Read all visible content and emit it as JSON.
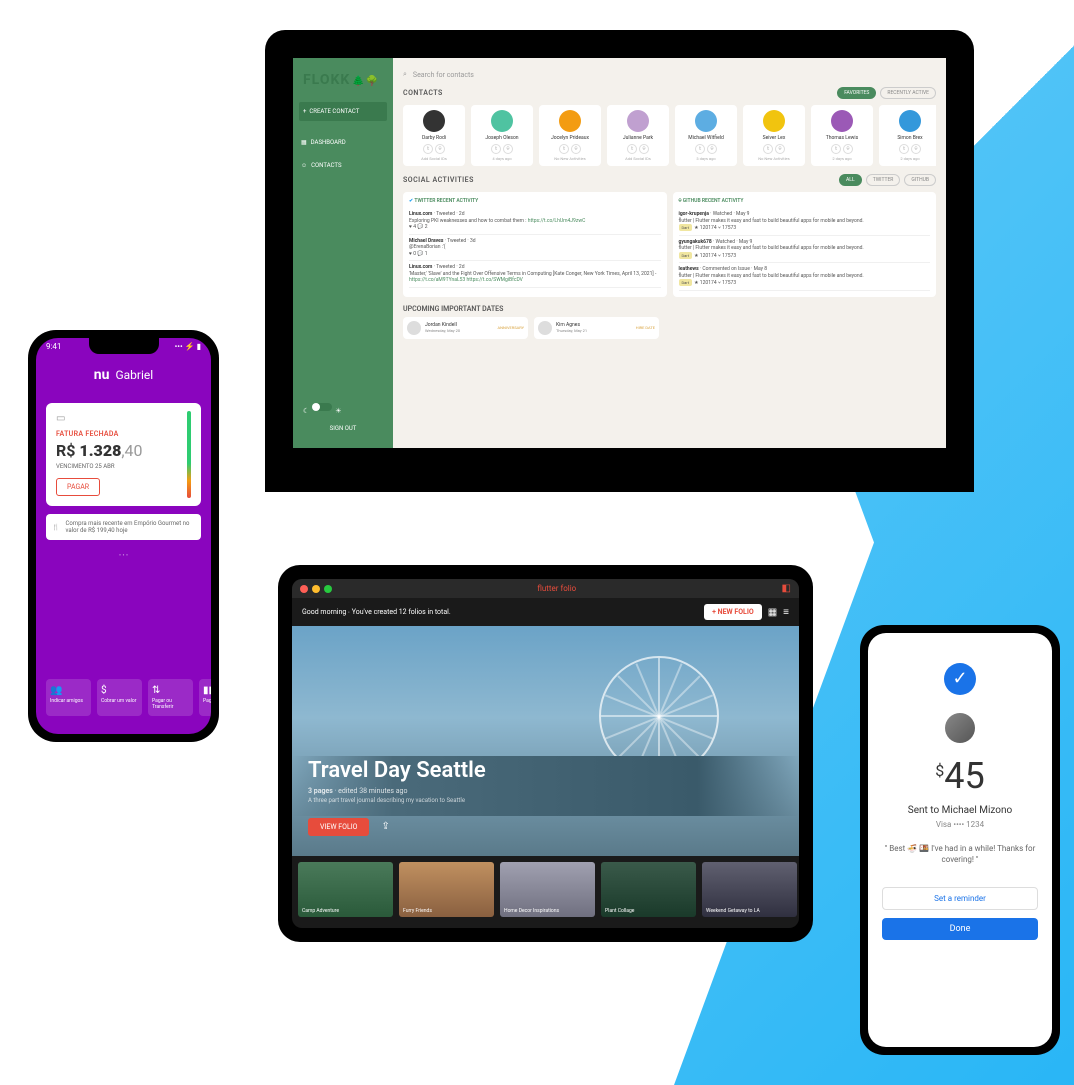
{
  "flokk": {
    "logo": "FLOKK",
    "search_placeholder": "Search for contacts",
    "create_contact": "CREATE CONTACT",
    "nav_dashboard": "DASHBOARD",
    "nav_contacts": "CONTACTS",
    "sign_out": "SIGN OUT",
    "contacts_heading": "CONTACTS",
    "tab_favorites": "FAVORITES",
    "tab_recently": "RECENTLY ACTIVE",
    "contacts": [
      {
        "name": "Darby Rodi",
        "meta": "Add Social IDs"
      },
      {
        "name": "Joseph Oleson",
        "meta": "4 days ago"
      },
      {
        "name": "Jocelyn Prideaux",
        "meta": "No New Activities"
      },
      {
        "name": "Julianne Park",
        "meta": "Add Social IDs"
      },
      {
        "name": "Michael Witfield",
        "meta": "3 days ago"
      },
      {
        "name": "Seiver Lex",
        "meta": "No New Activities"
      },
      {
        "name": "Thomas Lewis",
        "meta": "2 days ago"
      },
      {
        "name": "Simon Brex",
        "meta": "2 days ago"
      }
    ],
    "social_heading": "SOCIAL ACTIVITIES",
    "social_tab_all": "ALL",
    "social_tab_twitter": "TWITTER",
    "social_tab_github": "GITHUB",
    "twitter_header": "TWITTER RECENT ACTIVITY",
    "github_header": "GITHUB RECENT ACTIVITY",
    "twitter_items": [
      {
        "who": "Linux.com",
        "action": "Tweeted · 2d",
        "text": "Exploring PKI weaknesses and how to combat them :",
        "link": "https://t.co/LhUm4J9zwC",
        "stats": "♥ 4  💬 2"
      },
      {
        "who": "Michael Draves",
        "action": "Tweeted · 3d",
        "text": "@ErenaBorian :'(",
        "stats": "♥ 0  💬 1"
      },
      {
        "who": "Linux.com",
        "action": "Tweeted · 2d",
        "text": "'Master,' 'Slave' and the Fight Over Offensive Terms in Computing [Kate Conger, New York Times, April 13, 2021] -",
        "link": "https://t.co/aM9TYnaL53 https://t.co/SWMgiBfcDV"
      }
    ],
    "github_items": [
      {
        "who": "igor-krupenja",
        "action": "Watched · May 9",
        "text": "flutter | Flutter makes it easy and fast to build beautiful apps for mobile and beyond.",
        "lang": "Dart",
        "stats": "★ 120174  ⑂ 17573"
      },
      {
        "who": "gyungakuk678",
        "action": "Watched · May 9",
        "text": "flutter | Flutter makes it easy and fast to build beautiful apps for mobile and beyond.",
        "lang": "Dart",
        "stats": "★ 120174  ⑂ 17573"
      },
      {
        "who": "leathews",
        "action": "Commented on Issue · May 8",
        "text": "flutter | Flutter makes it easy and fast to build beautiful apps for mobile and beyond.",
        "lang": "Dart",
        "stats": "★ 120174  ⑂ 17573"
      }
    ],
    "dates_heading": "UPCOMING IMPORTANT DATES",
    "dates": [
      {
        "name": "Jordan Kindell",
        "badge": "ANNIVERSARY",
        "date": "Wednesday, May 20"
      },
      {
        "name": "Kim Agnes",
        "badge": "HIRE DATE",
        "date": "Thursday, May 21"
      }
    ]
  },
  "nubank": {
    "time": "9:41",
    "user": "Gabriel",
    "label": "FATURA FECHADA",
    "currency": "R$",
    "amount_int": "1.328",
    "amount_cents": ",40",
    "due": "VENCIMENTO 25 ABR",
    "pagar": "PAGAR",
    "recent": "Compra mais recente em Empório Gourmet no valor de R$ 199,40 hoje",
    "actions": [
      {
        "label": "Indicar amigos"
      },
      {
        "label": "Cobrar um valor"
      },
      {
        "label": "Pagar ou Transferir"
      },
      {
        "label": "Pagar boleto"
      }
    ]
  },
  "folio": {
    "title": "flutter folio",
    "greeting": "Good morning ∙ You've created 12 folios in total.",
    "new_folio": "+ NEW FOLIO",
    "hero_title": "Travel Day Seattle",
    "hero_pages": "3 pages",
    "hero_edited": "edited 38 minutes ago",
    "hero_desc": "A three part travel journal describing my vacation to Seattle",
    "view_btn": "VIEW FOLIO",
    "thumbs": [
      {
        "label": "Camp Adventure"
      },
      {
        "label": "Furry Friends"
      },
      {
        "label": "Home Decor Inspirations"
      },
      {
        "label": "Plant Collage"
      },
      {
        "label": "Weekend Getaway to LA"
      }
    ]
  },
  "gpay": {
    "amount": "45",
    "currency": "$",
    "sent_to": "Sent to Michael Mizono",
    "card": "Visa •••• 1234",
    "message": "\" Best 🍜 🍱 I've had in a while! Thanks for covering! \"",
    "reminder": "Set a reminder",
    "done": "Done"
  }
}
